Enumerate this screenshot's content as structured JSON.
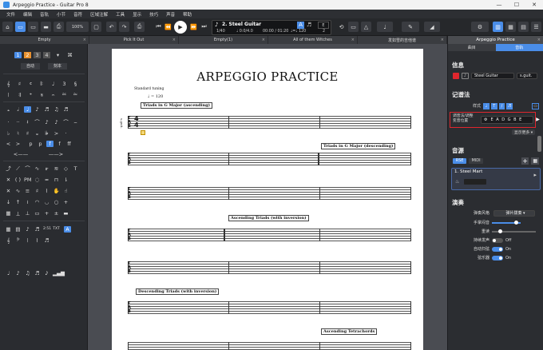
{
  "window": {
    "title": "Arpeggio Practice - Guitar Pro 8",
    "min": "—",
    "max": "☐",
    "close": "✕"
  },
  "menu": [
    "文件",
    "编辑",
    "音轨",
    "小节",
    "音符",
    "区域注解",
    "工具",
    "显示",
    "技巧",
    "声音",
    "帮助"
  ],
  "toolbar": {
    "zoom": "100%",
    "track_name": "2. Steel Guitar",
    "bar_pos": "1/40",
    "time_sig": "♩ 0:0/4.0",
    "time": "00:00 / 01:20",
    "tempo": "♩=♩ 120",
    "beat_e": "E",
    "beat_2": "2"
  },
  "tabs": [
    "Empty",
    "Pick It Out",
    "Empty(1)",
    "All of them Witches",
    "发如雪的吉他谱",
    "Arpeggio Practice"
  ],
  "score": {
    "title": "ARPEGGIO PRACTICE",
    "tuning": "Standard tuning",
    "tempo": "♩ = 120",
    "sections": [
      "Triads in G Major (ascending)",
      "Triads in G Major (descending)",
      "Ascending Triads (with inversion)",
      "Descending Triads (with inversion)",
      "Ascending Tetrachords"
    ],
    "tab_letters": [
      "T",
      "A",
      "B"
    ],
    "guitar_label": "s.guit."
  },
  "right": {
    "subtabs": [
      "曲目",
      "音轨"
    ],
    "info_title": "信息",
    "track_field": "Steel Guitar",
    "short_field": "s.guit.",
    "notation_title": "记谱法",
    "style_label": "样式",
    "tuning_label": "调音法/调整\n变音位置",
    "tuning_value": "E A D G B E",
    "show_more": "显示更多",
    "sound_title": "音源",
    "rse": "RSE",
    "midi": "MIDI",
    "instrument": "1. Steel Mart",
    "perf_title": "演奏",
    "picking_label": "弹奏风格",
    "picking_value": "弹片拨奏",
    "sustain_label": "手掌闷音",
    "vibrato_label": "重读",
    "let_ring_label": "持续发声",
    "off": "Off",
    "auto_label": "自动扫弦",
    "on": "On",
    "capo_label": "弦乐器",
    "on2": "On"
  },
  "palette": {
    "voices": [
      "1",
      "2",
      "3",
      "4"
    ],
    "quick1": "自动",
    "quick2": "刻本"
  }
}
